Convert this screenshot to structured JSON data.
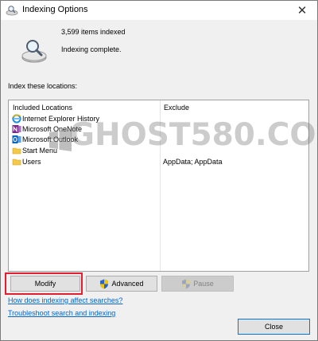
{
  "window": {
    "title": "Indexing Options",
    "close_glyph": "✕"
  },
  "status": {
    "items_indexed": "3,599 items indexed",
    "message": "Indexing complete."
  },
  "index_label": "Index these locations:",
  "locations": {
    "columns": [
      "Included Locations",
      "Exclude"
    ],
    "rows": [
      {
        "name": "Internet Explorer History",
        "exclude": "",
        "icon": "internet-explorer-icon"
      },
      {
        "name": "Microsoft OneNote",
        "exclude": "",
        "icon": "onenote-icon"
      },
      {
        "name": "Microsoft Outlook",
        "exclude": "",
        "icon": "outlook-icon"
      },
      {
        "name": "Start Menu",
        "exclude": "",
        "icon": "folder-icon"
      },
      {
        "name": "Users",
        "exclude": "AppData; AppData",
        "icon": "folder-icon"
      }
    ]
  },
  "buttons": {
    "modify": "Modify",
    "advanced": "Advanced",
    "pause": "Pause",
    "close": "Close"
  },
  "links": {
    "how": "How does indexing affect searches?",
    "troubleshoot": "Troubleshoot search and indexing"
  },
  "watermark": {
    "text": "GHOST580.COM"
  },
  "colors": {
    "highlight": "#e02030",
    "link": "#0066cc",
    "accent": "#0078d7",
    "shield_blue": "#2a62c8",
    "shield_yellow": "#f2c500"
  }
}
